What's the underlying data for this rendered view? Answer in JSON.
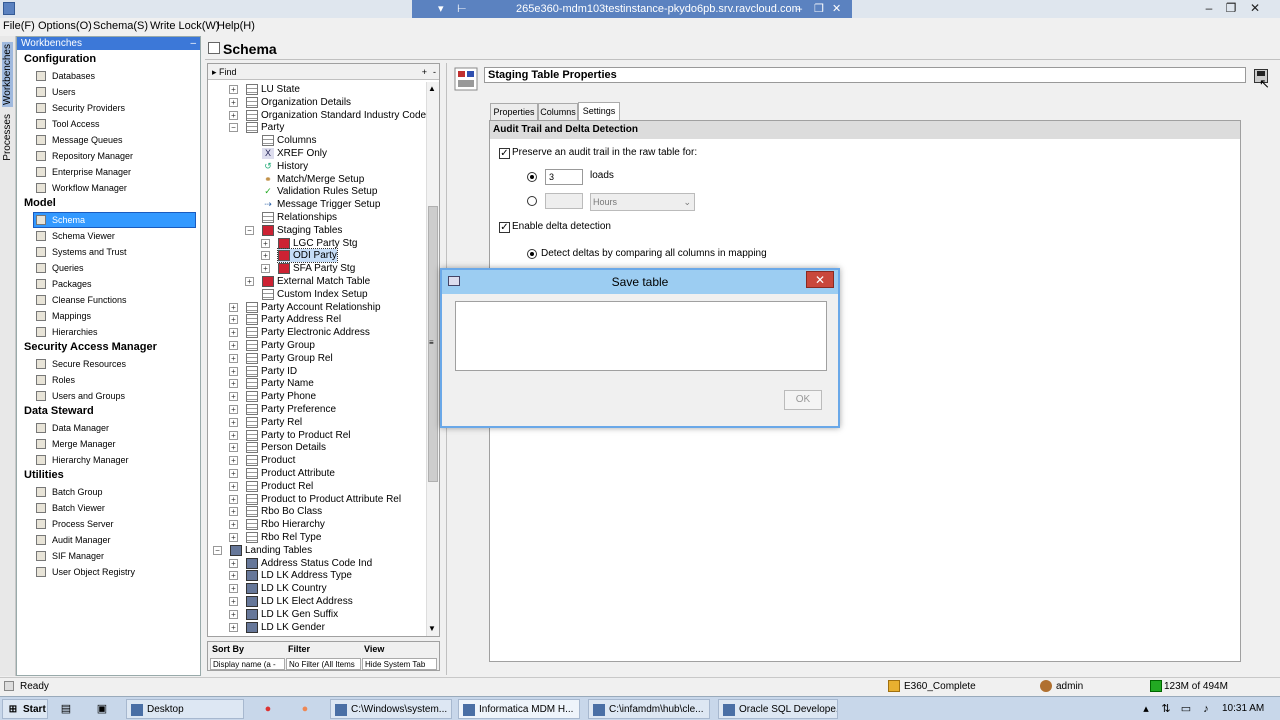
{
  "window": {
    "title": "265e360-mdm103testinstance-pkydo6pb.srv.ravcloud.com",
    "controls": [
      "–",
      "❐",
      "✕"
    ]
  },
  "menubar": [
    "File(F)",
    "Options(O)",
    "Schema(S)",
    "Write Lock(W)",
    "Help(H)"
  ],
  "sidebar": {
    "workbenches_tab": "Workbenches",
    "processes_tab": "Processes",
    "header": "Workbenches",
    "sections": [
      {
        "title": "Configuration",
        "items": [
          {
            "label": "Databases",
            "icon": "database-icon"
          },
          {
            "label": "Users",
            "icon": "user-icon"
          },
          {
            "label": "Security Providers",
            "icon": "security-providers-icon"
          },
          {
            "label": "Tool Access",
            "icon": "tool-access-icon"
          },
          {
            "label": "Message Queues",
            "icon": "message-queues-icon"
          },
          {
            "label": "Repository Manager",
            "icon": "repository-manager-icon"
          },
          {
            "label": "Enterprise Manager",
            "icon": "enterprise-manager-icon"
          },
          {
            "label": "Workflow Manager",
            "icon": "workflow-manager-icon"
          }
        ]
      },
      {
        "title": "Model",
        "items": [
          {
            "label": "Schema",
            "icon": "schema-icon",
            "selected": true
          },
          {
            "label": "Schema Viewer",
            "icon": "schema-viewer-icon"
          },
          {
            "label": "Systems and Trust",
            "icon": "systems-trust-icon"
          },
          {
            "label": "Queries",
            "icon": "queries-icon"
          },
          {
            "label": "Packages",
            "icon": "packages-icon"
          },
          {
            "label": "Cleanse Functions",
            "icon": "cleanse-functions-icon"
          },
          {
            "label": "Mappings",
            "icon": "mappings-icon"
          },
          {
            "label": "Hierarchies",
            "icon": "hierarchies-icon"
          }
        ]
      },
      {
        "title": "Security Access Manager",
        "items": [
          {
            "label": "Secure Resources",
            "icon": "secure-resources-icon"
          },
          {
            "label": "Roles",
            "icon": "roles-icon"
          },
          {
            "label": "Users and Groups",
            "icon": "users-groups-icon"
          }
        ]
      },
      {
        "title": "Data Steward",
        "items": [
          {
            "label": "Data Manager",
            "icon": "data-manager-icon"
          },
          {
            "label": "Merge Manager",
            "icon": "merge-manager-icon"
          },
          {
            "label": "Hierarchy Manager",
            "icon": "hierarchy-manager-icon"
          }
        ]
      },
      {
        "title": "Utilities",
        "items": [
          {
            "label": "Batch Group",
            "icon": "batch-group-icon"
          },
          {
            "label": "Batch Viewer",
            "icon": "batch-viewer-icon"
          },
          {
            "label": "Process Server",
            "icon": "process-server-icon"
          },
          {
            "label": "Audit Manager",
            "icon": "audit-manager-icon"
          },
          {
            "label": "SIF Manager",
            "icon": "sif-manager-icon"
          },
          {
            "label": "User Object Registry",
            "icon": "user-object-registry-icon"
          }
        ]
      }
    ]
  },
  "schema": {
    "title": "Schema",
    "find_label": "Find",
    "tree": [
      {
        "label": "LU State",
        "level": 1,
        "expander": "+",
        "icon": "table-icon"
      },
      {
        "label": "Organization Details",
        "level": 1,
        "expander": "+",
        "icon": "table-icon"
      },
      {
        "label": "Organization Standard Industry Code",
        "level": 1,
        "expander": "+",
        "icon": "table-icon"
      },
      {
        "label": "Party",
        "level": 1,
        "expander": "−",
        "icon": "table-icon"
      },
      {
        "label": "Columns",
        "level": 2,
        "expander": "",
        "icon": "columns-icon"
      },
      {
        "label": "XREF Only",
        "level": 2,
        "expander": "",
        "icon": "xref-icon"
      },
      {
        "label": "History",
        "level": 2,
        "expander": "",
        "icon": "history-icon"
      },
      {
        "label": "Match/Merge Setup",
        "level": 2,
        "expander": "",
        "icon": "match-merge-icon"
      },
      {
        "label": "Validation Rules Setup",
        "level": 2,
        "expander": "",
        "icon": "validation-check-icon"
      },
      {
        "label": "Message Trigger Setup",
        "level": 2,
        "expander": "",
        "icon": "message-trigger-icon"
      },
      {
        "label": "Relationships",
        "level": 2,
        "expander": "",
        "icon": "relationships-icon"
      },
      {
        "label": "Staging Tables",
        "level": 2,
        "expander": "−",
        "icon": "staging-tables-icon"
      },
      {
        "label": "LGC Party Stg",
        "level": 3,
        "expander": "+",
        "icon": "staging-table-icon"
      },
      {
        "label": "ODI Party",
        "level": 3,
        "expander": "+",
        "icon": "staging-table-icon",
        "selected": true
      },
      {
        "label": "SFA Party Stg",
        "level": 3,
        "expander": "+",
        "icon": "staging-table-icon"
      },
      {
        "label": "External Match Table",
        "level": 2,
        "expander": "+",
        "icon": "external-match-icon"
      },
      {
        "label": "Custom Index Setup",
        "level": 2,
        "expander": "",
        "icon": "table-icon"
      },
      {
        "label": "Party Account Relationship",
        "level": 1,
        "expander": "+",
        "icon": "table-icon"
      },
      {
        "label": "Party Address Rel",
        "level": 1,
        "expander": "+",
        "icon": "table-icon"
      },
      {
        "label": "Party Electronic Address",
        "level": 1,
        "expander": "+",
        "icon": "table-icon"
      },
      {
        "label": "Party Group",
        "level": 1,
        "expander": "+",
        "icon": "table-icon"
      },
      {
        "label": "Party Group Rel",
        "level": 1,
        "expander": "+",
        "icon": "table-icon"
      },
      {
        "label": "Party ID",
        "level": 1,
        "expander": "+",
        "icon": "table-icon"
      },
      {
        "label": "Party Name",
        "level": 1,
        "expander": "+",
        "icon": "table-icon"
      },
      {
        "label": "Party Phone",
        "level": 1,
        "expander": "+",
        "icon": "table-icon"
      },
      {
        "label": "Party Preference",
        "level": 1,
        "expander": "+",
        "icon": "table-icon"
      },
      {
        "label": "Party Rel",
        "level": 1,
        "expander": "+",
        "icon": "table-icon"
      },
      {
        "label": "Party to Product Rel",
        "level": 1,
        "expander": "+",
        "icon": "table-icon"
      },
      {
        "label": "Person Details",
        "level": 1,
        "expander": "+",
        "icon": "table-icon"
      },
      {
        "label": "Product",
        "level": 1,
        "expander": "+",
        "icon": "table-icon"
      },
      {
        "label": "Product Attribute",
        "level": 1,
        "expander": "+",
        "icon": "table-icon"
      },
      {
        "label": "Product Rel",
        "level": 1,
        "expander": "+",
        "icon": "table-icon"
      },
      {
        "label": "Product to Product Attribute Rel",
        "level": 1,
        "expander": "+",
        "icon": "table-icon"
      },
      {
        "label": "Rbo Bo Class",
        "level": 1,
        "expander": "+",
        "icon": "table-icon"
      },
      {
        "label": "Rbo Hierarchy",
        "level": 1,
        "expander": "+",
        "icon": "table-icon"
      },
      {
        "label": "Rbo Rel Type",
        "level": 1,
        "expander": "+",
        "icon": "table-icon"
      },
      {
        "label": "Landing Tables",
        "level": 0,
        "expander": "−",
        "icon": "landing-tables-icon"
      },
      {
        "label": "Address Status Code Ind",
        "level": 1,
        "expander": "+",
        "icon": "landing-table-icon"
      },
      {
        "label": "LD LK Address Type",
        "level": 1,
        "expander": "+",
        "icon": "landing-table-icon"
      },
      {
        "label": "LD LK Country",
        "level": 1,
        "expander": "+",
        "icon": "landing-table-icon"
      },
      {
        "label": "LD LK Elect Address",
        "level": 1,
        "expander": "+",
        "icon": "landing-table-icon"
      },
      {
        "label": "LD LK Gen Suffix",
        "level": 1,
        "expander": "+",
        "icon": "landing-table-icon"
      },
      {
        "label": "LD LK Gender",
        "level": 1,
        "expander": "+",
        "icon": "landing-table-icon"
      }
    ],
    "sort": {
      "headers": [
        "Sort By",
        "Filter",
        "View"
      ],
      "values": [
        "Display name (a -",
        "No Filter (All Items",
        "Hide System Tab"
      ]
    }
  },
  "properties": {
    "title": "Staging Table Properties",
    "tabs": [
      {
        "label": "Properties",
        "active": false
      },
      {
        "label": "Columns",
        "active": false
      },
      {
        "label": "Settings",
        "active": true
      }
    ],
    "section_title": "Audit Trail and Delta Detection",
    "audit_checkbox_label": "Preserve an audit trail in the raw table for:",
    "loads_value": "3",
    "loads_label": "loads",
    "hours_value": "",
    "hours_select": "Hours",
    "delta_checkbox_label": "Enable delta detection",
    "delta_option_label": "Detect deltas by comparing all columns in mapping"
  },
  "dialog": {
    "title": "Save table",
    "close": "✕",
    "message": "",
    "ok_label": "OK"
  },
  "status": {
    "left": "Ready",
    "database": "E360_Complete",
    "user": "admin",
    "memory": "123M of 494M"
  },
  "taskbar": {
    "start": "Start",
    "items": [
      {
        "label": "Desktop",
        "icon": "desktop-icon"
      },
      {
        "label": "C:\\Windows\\system...",
        "icon": "cmd-icon"
      },
      {
        "label": "Informatica MDM H...",
        "icon": "informatica-icon",
        "active": true
      },
      {
        "label": "C:\\infamdm\\hub\\cle...",
        "icon": "notepad-icon"
      },
      {
        "label": "Oracle SQL Develope...",
        "icon": "oracle-sql-icon"
      }
    ],
    "clock": "10:31 AM"
  }
}
